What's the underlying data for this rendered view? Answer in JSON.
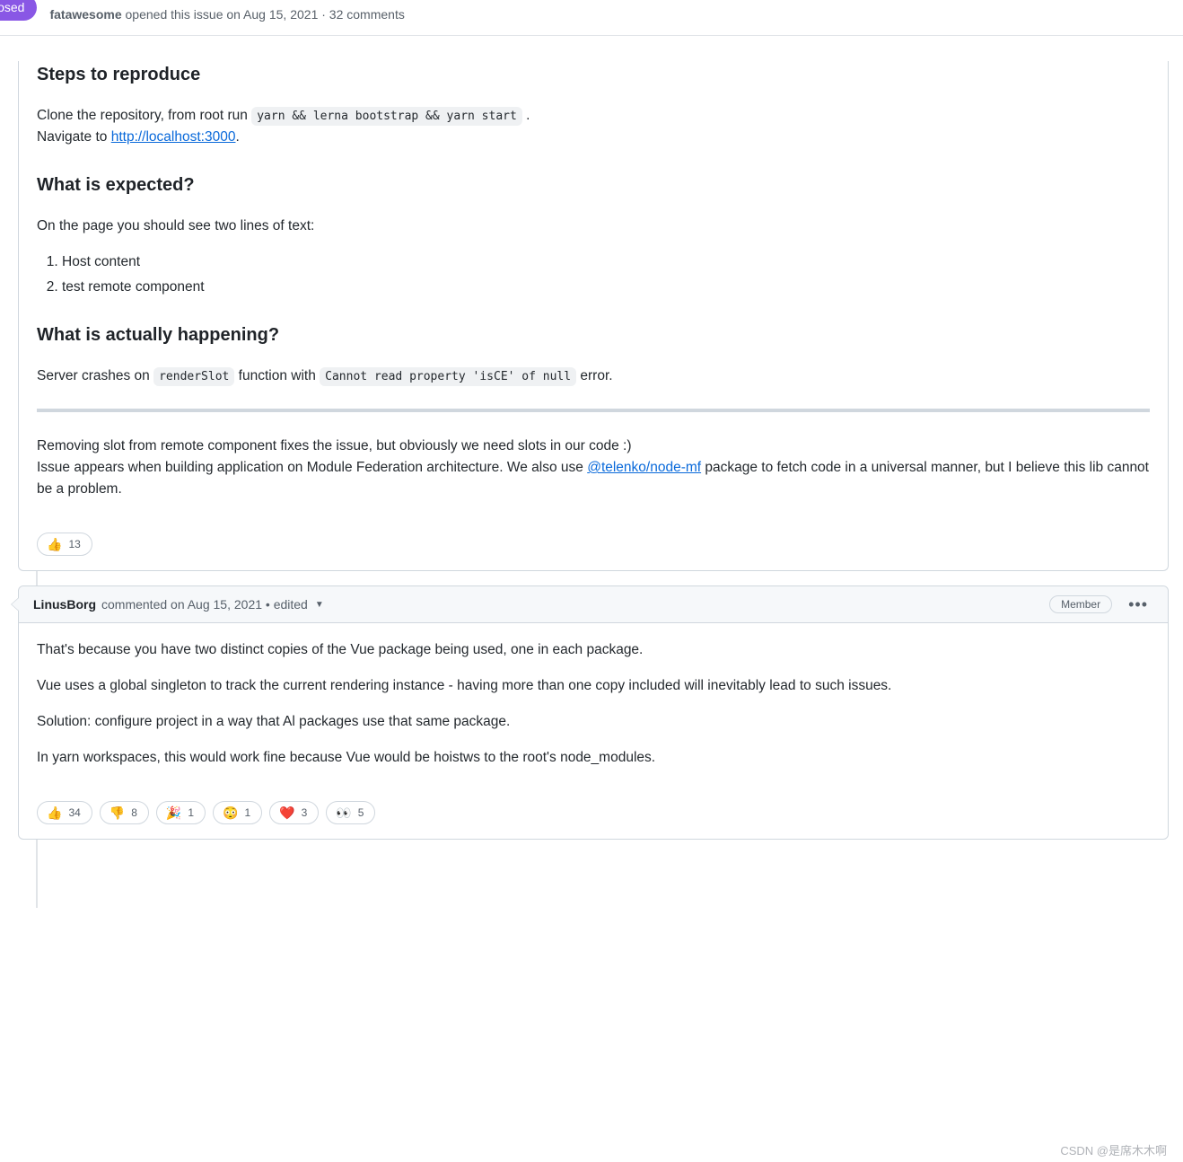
{
  "issue": {
    "status_badge": "losed",
    "author": "fatawesome",
    "meta_opened": " opened this issue on Aug 15, 2021 · 32 comments"
  },
  "body": {
    "h_steps": "Steps to reproduce",
    "p_clone_1": "Clone the repository, from root run ",
    "code_cmd": "yarn && lerna bootstrap && yarn start",
    "p_clone_2": " .",
    "p_nav_1": "Navigate to ",
    "link_localhost": "http://localhost:3000",
    "p_nav_2": ".",
    "h_expected": "What is expected?",
    "p_expected": "On the page you should see two lines of text:",
    "li1": "Host content",
    "li2": "test remote component",
    "h_actual": "What is actually happening?",
    "p_actual_1": "Server crashes on ",
    "code_renderSlot": "renderSlot",
    "p_actual_2": " function with ",
    "code_err": "Cannot read property 'isCE' of null",
    "p_actual_3": " error.",
    "p_remove": "Removing slot from remote component fixes the issue, but obviously we need slots in our code :)",
    "p_issue_1": "Issue appears when building application on Module Federation architecture. We also use ",
    "link_pkg": "@telenko/node-mf",
    "p_issue_2": " package to fetch code in a universal manner, but I believe this lib cannot be a problem."
  },
  "reactions1": {
    "thumbsup": {
      "emoji": "👍",
      "count": "13"
    }
  },
  "comment2": {
    "author": "LinusBorg",
    "meta": " commented on Aug 15, 2021 • edited",
    "member": "Member",
    "p1": "That's because you have two distinct copies of the Vue package being used, one in each package.",
    "p2": "Vue uses a global singleton to track the current rendering instance - having more than one copy included will inevitably lead to such issues.",
    "p3": "Solution: configure project in a way that Al packages use that same package.",
    "p4": "In yarn workspaces, this would work fine because Vue would be hoistws to the root's node_modules."
  },
  "reactions2": [
    {
      "emoji": "👍",
      "count": "34"
    },
    {
      "emoji": "👎",
      "count": "8"
    },
    {
      "emoji": "🎉",
      "count": "1"
    },
    {
      "emoji": "😳",
      "count": "1"
    },
    {
      "emoji": "❤️",
      "count": "3"
    },
    {
      "emoji": "👀",
      "count": "5"
    }
  ],
  "watermark": "CSDN @是席木木啊"
}
